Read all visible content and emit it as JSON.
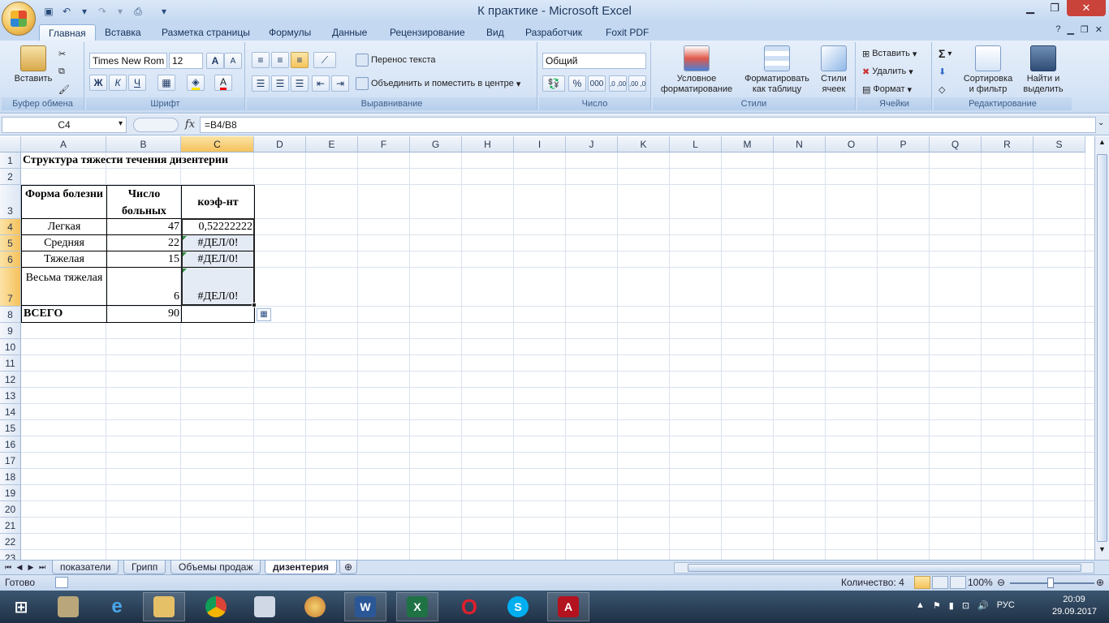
{
  "window": {
    "title": "К практике - Microsoft Excel"
  },
  "tabs": [
    "Главная",
    "Вставка",
    "Разметка страницы",
    "Формулы",
    "Данные",
    "Рецензирование",
    "Вид",
    "Разработчик",
    "Foxit PDF"
  ],
  "ribbon": {
    "clipboard": {
      "paste": "Вставить",
      "label": "Буфер обмена"
    },
    "font": {
      "name": "Times New Rom",
      "size": "12",
      "bold": "Ж",
      "italic": "К",
      "underline": "Ч",
      "grow": "A",
      "shrink": "A",
      "label": "Шрифт"
    },
    "alignment": {
      "wrap": "Перенос текста",
      "merge": "Объединить и поместить в центре",
      "label": "Выравнивание"
    },
    "number": {
      "format": "Общий",
      "percent": "%",
      "thousands": "000",
      "inc": ",0 ,00",
      "dec": ",00 ,0",
      "label": "Число"
    },
    "styles": {
      "conditional": "Условное форматирование",
      "table": "Форматировать как таблицу",
      "cell": "Стили ячеек",
      "label": "Стили"
    },
    "cells": {
      "insert": "Вставить",
      "delete": "Удалить",
      "format": "Формат",
      "label": "Ячейки"
    },
    "editing": {
      "sum": "Σ",
      "sort": "Сортировка и фильтр",
      "find": "Найти и выделить",
      "label": "Редактирование"
    }
  },
  "formula_bar": {
    "name_box": "C4",
    "fx": "fx",
    "formula": "=B4/B8"
  },
  "columns": [
    "A",
    "B",
    "C",
    "D",
    "E",
    "F",
    "G",
    "H",
    "I",
    "J",
    "K",
    "L",
    "M",
    "N",
    "O",
    "P",
    "Q",
    "R",
    "S"
  ],
  "rows": [
    "1",
    "2",
    "3",
    "4",
    "5",
    "6",
    "7",
    "8",
    "9",
    "10",
    "11",
    "12",
    "13",
    "14",
    "15",
    "16",
    "17",
    "18",
    "19",
    "20",
    "21",
    "22",
    "23"
  ],
  "cells": {
    "A1": "Структура тяжести течения дизентерии",
    "A3": "Форма болезни",
    "B3": "Число больных",
    "C3": "коэф-нт",
    "A4": "Легкая",
    "B4": "47",
    "C4": "0,52222222",
    "A5": "Средняя",
    "B5": "22",
    "C5": "#ДЕЛ/0!",
    "A6": "Тяжелая",
    "B6": "15",
    "C6": "#ДЕЛ/0!",
    "A7": "Весьма тяжелая",
    "B7": "6",
    "C7": "#ДЕЛ/0!",
    "A8": "ВСЕГО",
    "B8": "90"
  },
  "sheets": [
    "показатели",
    "Грипп",
    "Объемы продаж",
    "дизентерия"
  ],
  "active_sheet": "дизентерия",
  "status": {
    "ready": "Готово",
    "count": "Количество: 4",
    "zoom": "100%"
  },
  "taskbar": {
    "lang": "РУС",
    "time": "20:09",
    "date": "29.09.2017"
  },
  "colors": {
    "accent": "#f5c15c",
    "ribbon": "#d6e4f6",
    "excel_green": "#1f7244"
  }
}
